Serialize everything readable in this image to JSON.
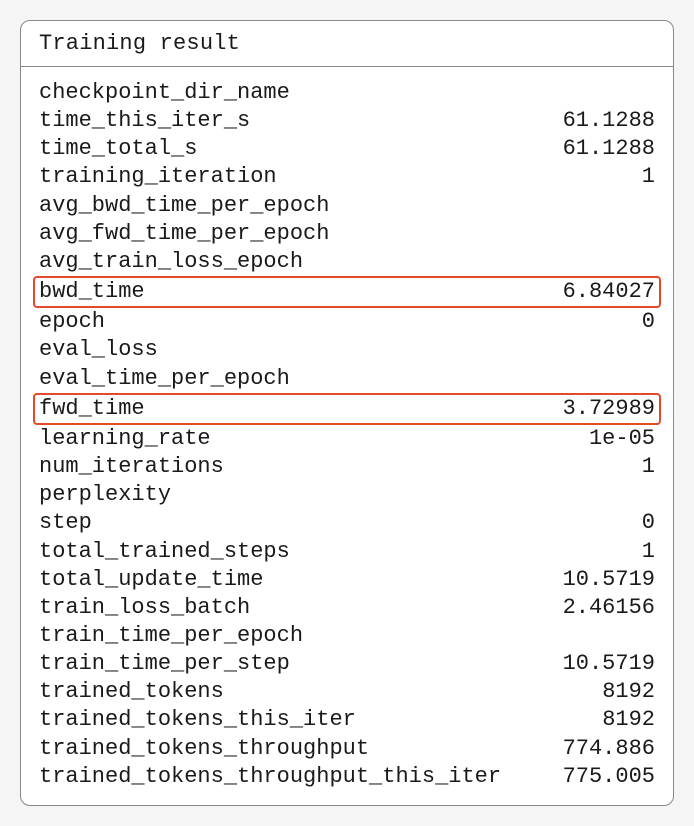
{
  "title": "Training result",
  "rows": [
    {
      "key": "checkpoint_dir_name",
      "val": "",
      "highlight": false
    },
    {
      "key": "time_this_iter_s",
      "val": "61.1288",
      "highlight": false
    },
    {
      "key": "time_total_s",
      "val": "61.1288",
      "highlight": false
    },
    {
      "key": "training_iteration",
      "val": "1",
      "highlight": false
    },
    {
      "key": "avg_bwd_time_per_epoch",
      "val": "",
      "highlight": false
    },
    {
      "key": "avg_fwd_time_per_epoch",
      "val": "",
      "highlight": false
    },
    {
      "key": "avg_train_loss_epoch",
      "val": "",
      "highlight": false
    },
    {
      "key": "bwd_time",
      "val": "6.84027",
      "highlight": true
    },
    {
      "key": "epoch",
      "val": "0",
      "highlight": false
    },
    {
      "key": "eval_loss",
      "val": "",
      "highlight": false
    },
    {
      "key": "eval_time_per_epoch",
      "val": "",
      "highlight": false
    },
    {
      "key": "fwd_time",
      "val": "3.72989",
      "highlight": true
    },
    {
      "key": "learning_rate",
      "val": "1e-05",
      "highlight": false
    },
    {
      "key": "num_iterations",
      "val": "1",
      "highlight": false
    },
    {
      "key": "perplexity",
      "val": "",
      "highlight": false
    },
    {
      "key": "step",
      "val": "0",
      "highlight": false
    },
    {
      "key": "total_trained_steps",
      "val": "1",
      "highlight": false
    },
    {
      "key": "total_update_time",
      "val": "10.5719",
      "highlight": false
    },
    {
      "key": "train_loss_batch",
      "val": "2.46156",
      "highlight": false
    },
    {
      "key": "train_time_per_epoch",
      "val": "",
      "highlight": false
    },
    {
      "key": "train_time_per_step",
      "val": "10.5719",
      "highlight": false
    },
    {
      "key": "trained_tokens",
      "val": "8192",
      "highlight": false
    },
    {
      "key": "trained_tokens_this_iter",
      "val": "8192",
      "highlight": false
    },
    {
      "key": "trained_tokens_throughput",
      "val": "774.886",
      "highlight": false
    },
    {
      "key": "trained_tokens_throughput_this_iter",
      "val": "775.005",
      "highlight": false
    }
  ]
}
